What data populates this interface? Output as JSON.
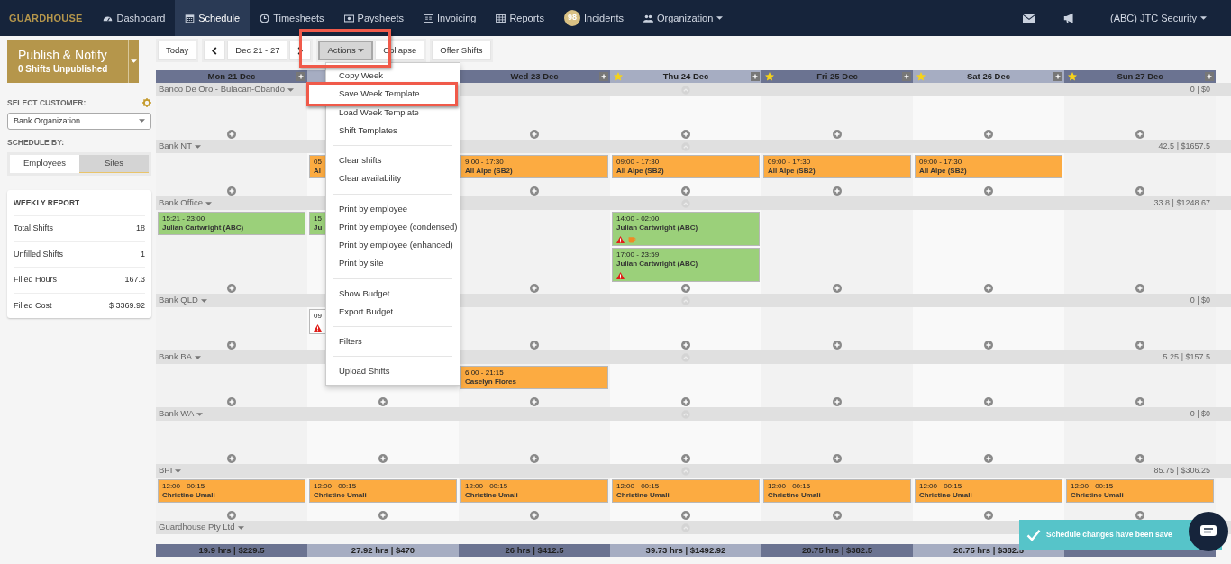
{
  "brand": "GUARDHOUSE",
  "nav": [
    {
      "label": "Dashboard",
      "selected": false
    },
    {
      "label": "Schedule",
      "selected": true
    },
    {
      "label": "Timesheets",
      "selected": false
    },
    {
      "label": "Paysheets",
      "selected": false
    },
    {
      "label": "Invoicing",
      "selected": false
    },
    {
      "label": "Reports",
      "selected": false
    },
    {
      "label": "Incidents",
      "selected": false,
      "badge": "98"
    },
    {
      "label": "Organization",
      "selected": false,
      "dropdown": true
    }
  ],
  "account": "(ABC) JTC Security",
  "sidebar": {
    "publish": {
      "title": "Publish & Notify",
      "subtitle": "0 Shifts Unpublished"
    },
    "customer_label": "SELECT CUSTOMER:",
    "customer": "Bank Organization",
    "schedule_by_label": "SCHEDULE BY:",
    "schedule_by": [
      {
        "label": "Employees",
        "selected": false
      },
      {
        "label": "Sites",
        "selected": true
      }
    ],
    "report": {
      "title": "WEEKLY REPORT",
      "rows": [
        {
          "label": "Total Shifts",
          "value": "18"
        },
        {
          "label": "Unfilled Shifts",
          "value": "1"
        },
        {
          "label": "Filled Hours",
          "value": "167.3"
        },
        {
          "label": "Filled Cost",
          "value": "$ 3369.92"
        }
      ]
    }
  },
  "toolbar": {
    "today": "Today",
    "range": "Dec 21 - 27",
    "actions": "Actions",
    "actions_highlighted": true,
    "collapse": "Collapse",
    "offer": "Offer Shifts"
  },
  "actions_menu": {
    "sections": [
      [
        {
          "label": "Copy Week",
          "highlighted": false
        },
        {
          "label": "Save Week Template",
          "highlighted": true
        },
        {
          "label": "Load Week Template",
          "highlighted": false
        },
        {
          "label": "Shift Templates",
          "highlighted": false
        }
      ],
      [
        {
          "label": "Clear shifts",
          "highlighted": false
        },
        {
          "label": "Clear availability",
          "highlighted": false
        }
      ],
      [
        {
          "label": "Print by employee",
          "highlighted": false
        },
        {
          "label": "Print by employee (condensed)",
          "highlighted": false
        },
        {
          "label": "Print by employee (enhanced)",
          "highlighted": false
        },
        {
          "label": "Print by site",
          "highlighted": false
        }
      ],
      [
        {
          "label": "Show Budget",
          "highlighted": false
        },
        {
          "label": "Export Budget",
          "highlighted": false
        }
      ],
      [
        {
          "label": "Filters",
          "highlighted": false
        }
      ],
      [
        {
          "label": "Upload Shifts",
          "highlighted": false
        }
      ]
    ]
  },
  "days": [
    {
      "label": "Mon 21 Dec",
      "holiday": false,
      "footer": "19.9 hrs | $229.5"
    },
    {
      "holiday": false,
      "footer": "27.92 hrs | $470"
    },
    {
      "label": "Wed 23 Dec",
      "holiday": false,
      "footer": "26 hrs | $412.5"
    },
    {
      "label": "Thu 24 Dec",
      "holiday": true,
      "footer": "39.73 hrs | $1492.92"
    },
    {
      "label": "Fri 25 Dec",
      "holiday": true,
      "footer": "20.75 hrs | $382.5"
    },
    {
      "label": "Sat 26 Dec",
      "holiday": true,
      "footer": "20.75 hrs | $382.5"
    },
    {
      "label": "Sun 27 Dec",
      "holiday": true
    }
  ],
  "groups": [
    {
      "name": "Banco De Oro - Bulacan-Obando",
      "total": "0 | $0",
      "cells": [
        [],
        [],
        [],
        [],
        [],
        [],
        []
      ]
    },
    {
      "name": "Bank NT",
      "total": "42.5 | $1657.5",
      "cells": [
        [],
        [
          {
            "time": "05",
            "name": "Al",
            "kind": "pending",
            "warning": false,
            "break": false
          }
        ],
        [
          {
            "time": "9:00 - 17:30",
            "name": "All Alpe (SB2)",
            "kind": "pending",
            "warning": false,
            "break": false
          }
        ],
        [
          {
            "time": "09:00 - 17:30",
            "name": "All Alpe (SB2)",
            "kind": "pending",
            "warning": false,
            "break": false
          }
        ],
        [
          {
            "time": "09:00 - 17:30",
            "name": "All Alpe (SB2)",
            "kind": "pending",
            "warning": false,
            "break": false
          }
        ],
        [
          {
            "time": "09:00 - 17:30",
            "name": "All Alpe (SB2)",
            "kind": "pending",
            "warning": false,
            "break": false
          }
        ],
        []
      ]
    },
    {
      "name": "Bank Office",
      "total": "33.8 | $1248.67",
      "cells": [
        [
          {
            "time": "15:21 - 23:00",
            "name": "Julian Cartwright (ABC)",
            "kind": "confirmed",
            "warning": false,
            "break": false
          }
        ],
        [
          {
            "time": "15",
            "name": "Ju",
            "kind": "confirmed",
            "warning": false,
            "break": false
          }
        ],
        [],
        [
          {
            "time": "14:00 - 02:00",
            "name": "Julian Cartwright (ABC)",
            "kind": "confirmed",
            "warning": true,
            "break": true
          },
          {
            "time": "17:00 - 23:59",
            "name": "Julian Cartwright (ABC)",
            "kind": "confirmed",
            "warning": true,
            "break": false
          }
        ],
        [],
        [],
        []
      ]
    },
    {
      "name": "Bank QLD",
      "total": "0 | $0",
      "cells": [
        [],
        [
          {
            "time": "09",
            "kind": "open",
            "warning": true,
            "break": false
          }
        ],
        [],
        [],
        [],
        [],
        []
      ]
    },
    {
      "name": "Bank BA",
      "total": "5.25 | $157.5",
      "cells": [
        [],
        [],
        [
          {
            "time": "6:00 - 21:15",
            "name": "Caselyn Flores",
            "kind": "pending",
            "warning": false,
            "break": false
          }
        ],
        [],
        [],
        [],
        []
      ]
    },
    {
      "name": "Bank WA",
      "total": "0 | $0",
      "cells": [
        [],
        [],
        [],
        [],
        [],
        [],
        []
      ]
    },
    {
      "name": "BPI",
      "total": "85.75 | $306.25",
      "cells": [
        [
          {
            "time": "12:00 - 00:15",
            "name": "Christine Umali",
            "kind": "pending",
            "warning": false,
            "break": false
          }
        ],
        [
          {
            "time": "12:00 - 00:15",
            "name": "Christine Umali",
            "kind": "pending",
            "warning": false,
            "break": false
          }
        ],
        [
          {
            "time": "12:00 - 00:15",
            "name": "Christine Umali",
            "kind": "pending",
            "warning": false,
            "break": false
          }
        ],
        [
          {
            "time": "12:00 - 00:15",
            "name": "Christine Umali",
            "kind": "pending",
            "warning": false,
            "break": false
          }
        ],
        [
          {
            "time": "12:00 - 00:15",
            "name": "Christine Umali",
            "kind": "pending",
            "warning": false,
            "break": false
          }
        ],
        [
          {
            "time": "12:00 - 00:15",
            "name": "Christine Umali",
            "kind": "pending",
            "warning": false,
            "break": false
          }
        ],
        [
          {
            "time": "12:00 - 00:15",
            "name": "Christine Umali",
            "kind": "pending",
            "warning": false,
            "break": false
          }
        ]
      ]
    },
    {
      "name": "Guardhouse Pty Ltd"
    }
  ],
  "toast": {
    "text": "Schedule changes have been save"
  }
}
